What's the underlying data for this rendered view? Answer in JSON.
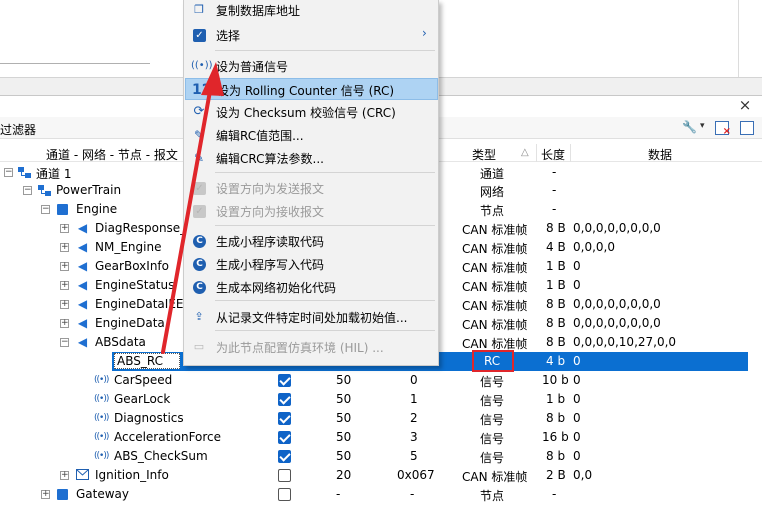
{
  "menu": {
    "items": [
      {
        "label": "复制数据库地址",
        "icon": "copy-icon",
        "disabled": false
      },
      {
        "label": "选择",
        "icon": "checkbox-icon",
        "disabled": false,
        "submenu": true
      },
      {
        "label": "设为普通信号",
        "icon": "signal-icon",
        "disabled": false
      },
      {
        "label": "设为 Rolling Counter 信号 (RC)",
        "icon": "counter-12-icon",
        "disabled": false,
        "highlighted": true
      },
      {
        "label": "设为 Checksum 校验信号 (CRC)",
        "icon": "crc-icon",
        "disabled": false
      },
      {
        "label": "编辑RC值范围...",
        "icon": "edit-icon",
        "disabled": false
      },
      {
        "label": "编辑CRC算法参数...",
        "icon": "edit-icon",
        "disabled": false
      },
      {
        "label": "设置方向为发送报文",
        "icon": "checkbox-icon",
        "disabled": true
      },
      {
        "label": "设置方向为接收报文",
        "icon": "checkbox-icon",
        "disabled": true
      },
      {
        "label": "生成小程序读取代码",
        "icon": "code-gen-icon",
        "disabled": false
      },
      {
        "label": "生成小程序写入代码",
        "icon": "code-gen-icon",
        "disabled": false
      },
      {
        "label": "生成本网络初始化代码",
        "icon": "code-gen-icon",
        "disabled": false
      },
      {
        "label": "从记录文件特定时间处加载初始值...",
        "icon": "load-file-icon",
        "disabled": false
      },
      {
        "label": "为此节点配置仿真环境 (HIL) ...",
        "icon": "hil-icon",
        "disabled": true
      }
    ],
    "submenu_glyph": "›"
  },
  "panel": {
    "close_glyph": "×",
    "filter_label": "过滤器"
  },
  "columns": {
    "tree": "通道 - 网络 - 节点 - 报文",
    "type": "类型",
    "sort_glyph": "△",
    "length": "长度",
    "data": "数据"
  },
  "tree": [
    {
      "name": "通道 1",
      "type": "通道",
      "length": "-",
      "data": ""
    },
    {
      "name": "PowerTrain",
      "type": "网络",
      "length": "-",
      "data": ""
    },
    {
      "name": "Engine",
      "type": "节点",
      "length": "-",
      "data": ""
    },
    {
      "name": "DiagResponse_M",
      "type": "CAN 标准帧",
      "length": "8 B",
      "data": "0,0,0,0,0,0,0,0"
    },
    {
      "name": "NM_Engine",
      "type": "CAN 标准帧",
      "length": "4 B",
      "data": "0,0,0,0"
    },
    {
      "name": "GearBoxInfo",
      "type": "CAN 标准帧",
      "length": "1 B",
      "data": "0"
    },
    {
      "name": "EngineStatus",
      "type": "CAN 标准帧",
      "length": "1 B",
      "data": "0"
    },
    {
      "name": "EngineDataIEEE",
      "type": "CAN 标准帧",
      "length": "8 B",
      "data": "0,0,0,0,0,0,0,0"
    },
    {
      "name": "EngineData",
      "type": "CAN 标准帧",
      "length": "8 B",
      "data": "0,0,0,0,0,0,0,0"
    },
    {
      "name": "ABSdata",
      "type": "CAN 标准帧",
      "length": "8 B",
      "data": "0,0,0,0,10,27,0,0"
    },
    {
      "name": "ABS_RC",
      "type": "RC",
      "length": "4 b",
      "data": "0"
    },
    {
      "name": "CarSpeed",
      "checked": true,
      "col1": "50",
      "col2": "0",
      "type": "信号",
      "length": "10 b",
      "data": "0"
    },
    {
      "name": "GearLock",
      "checked": true,
      "col1": "50",
      "col2": "1",
      "type": "信号",
      "length": "1 b",
      "data": "0"
    },
    {
      "name": "Diagnostics",
      "checked": true,
      "col1": "50",
      "col2": "2",
      "type": "信号",
      "length": "8 b",
      "data": "0"
    },
    {
      "name": "AccelerationForce",
      "checked": true,
      "col1": "50",
      "col2": "3",
      "type": "信号",
      "length": "16 b",
      "data": "0"
    },
    {
      "name": "ABS_CheckSum",
      "checked": true,
      "col1": "50",
      "col2": "5",
      "type": "信号",
      "length": "8 b",
      "data": "0"
    },
    {
      "name": "Ignition_Info",
      "checked": false,
      "col1": "20",
      "col2": "0x067",
      "type": "CAN 标准帧",
      "length": "2 B",
      "data": "0,0"
    },
    {
      "name": "Gateway",
      "checked": false,
      "col1": "-",
      "col2": "-",
      "type": "节点",
      "length": "-",
      "data": ""
    }
  ],
  "glyphs": {
    "expand": "+",
    "collapse": "−",
    "signal": "((•))",
    "message": "◀",
    "wrench": "🔧",
    "caret": "▾",
    "counter_icon": "12",
    "crc_icon": "⟳",
    "edit_icon": "✎",
    "gen_icon": "C",
    "load_icon": "⇪",
    "hil_icon": "▭",
    "copy_icon": "❐",
    "check_icon": "✓"
  },
  "colors": {
    "selection": "#0b6fd1",
    "menu_highlight": "#aed3f3",
    "accent": "#1f5fb0",
    "annotation": "#e0262b"
  }
}
